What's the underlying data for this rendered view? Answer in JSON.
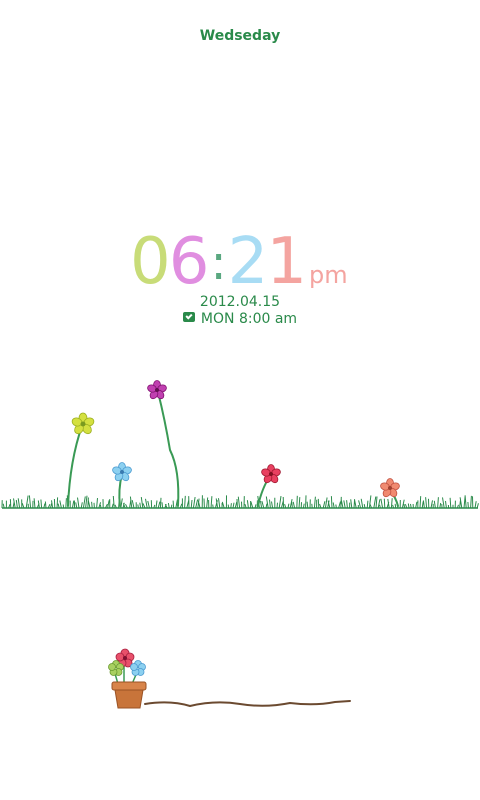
{
  "day": "Wedseday",
  "clock": {
    "hour_tens": "0",
    "hour_ones": "6",
    "separator": ":",
    "minute_tens": "2",
    "minute_ones": "1",
    "ampm": "pm"
  },
  "date": "2012.04.15",
  "alarm": {
    "icon": "alarm-icon",
    "text": "MON 8:00 am"
  },
  "colors": {
    "text_green": "#2a8a4a",
    "digit_0": "#c8dc78",
    "digit_6": "#e08ee0",
    "digit_2": "#a8dcf4",
    "digit_1": "#f4a4a0",
    "grass": "#2a8a4a",
    "pot": "#c8743a",
    "root": "#6b4a30"
  }
}
